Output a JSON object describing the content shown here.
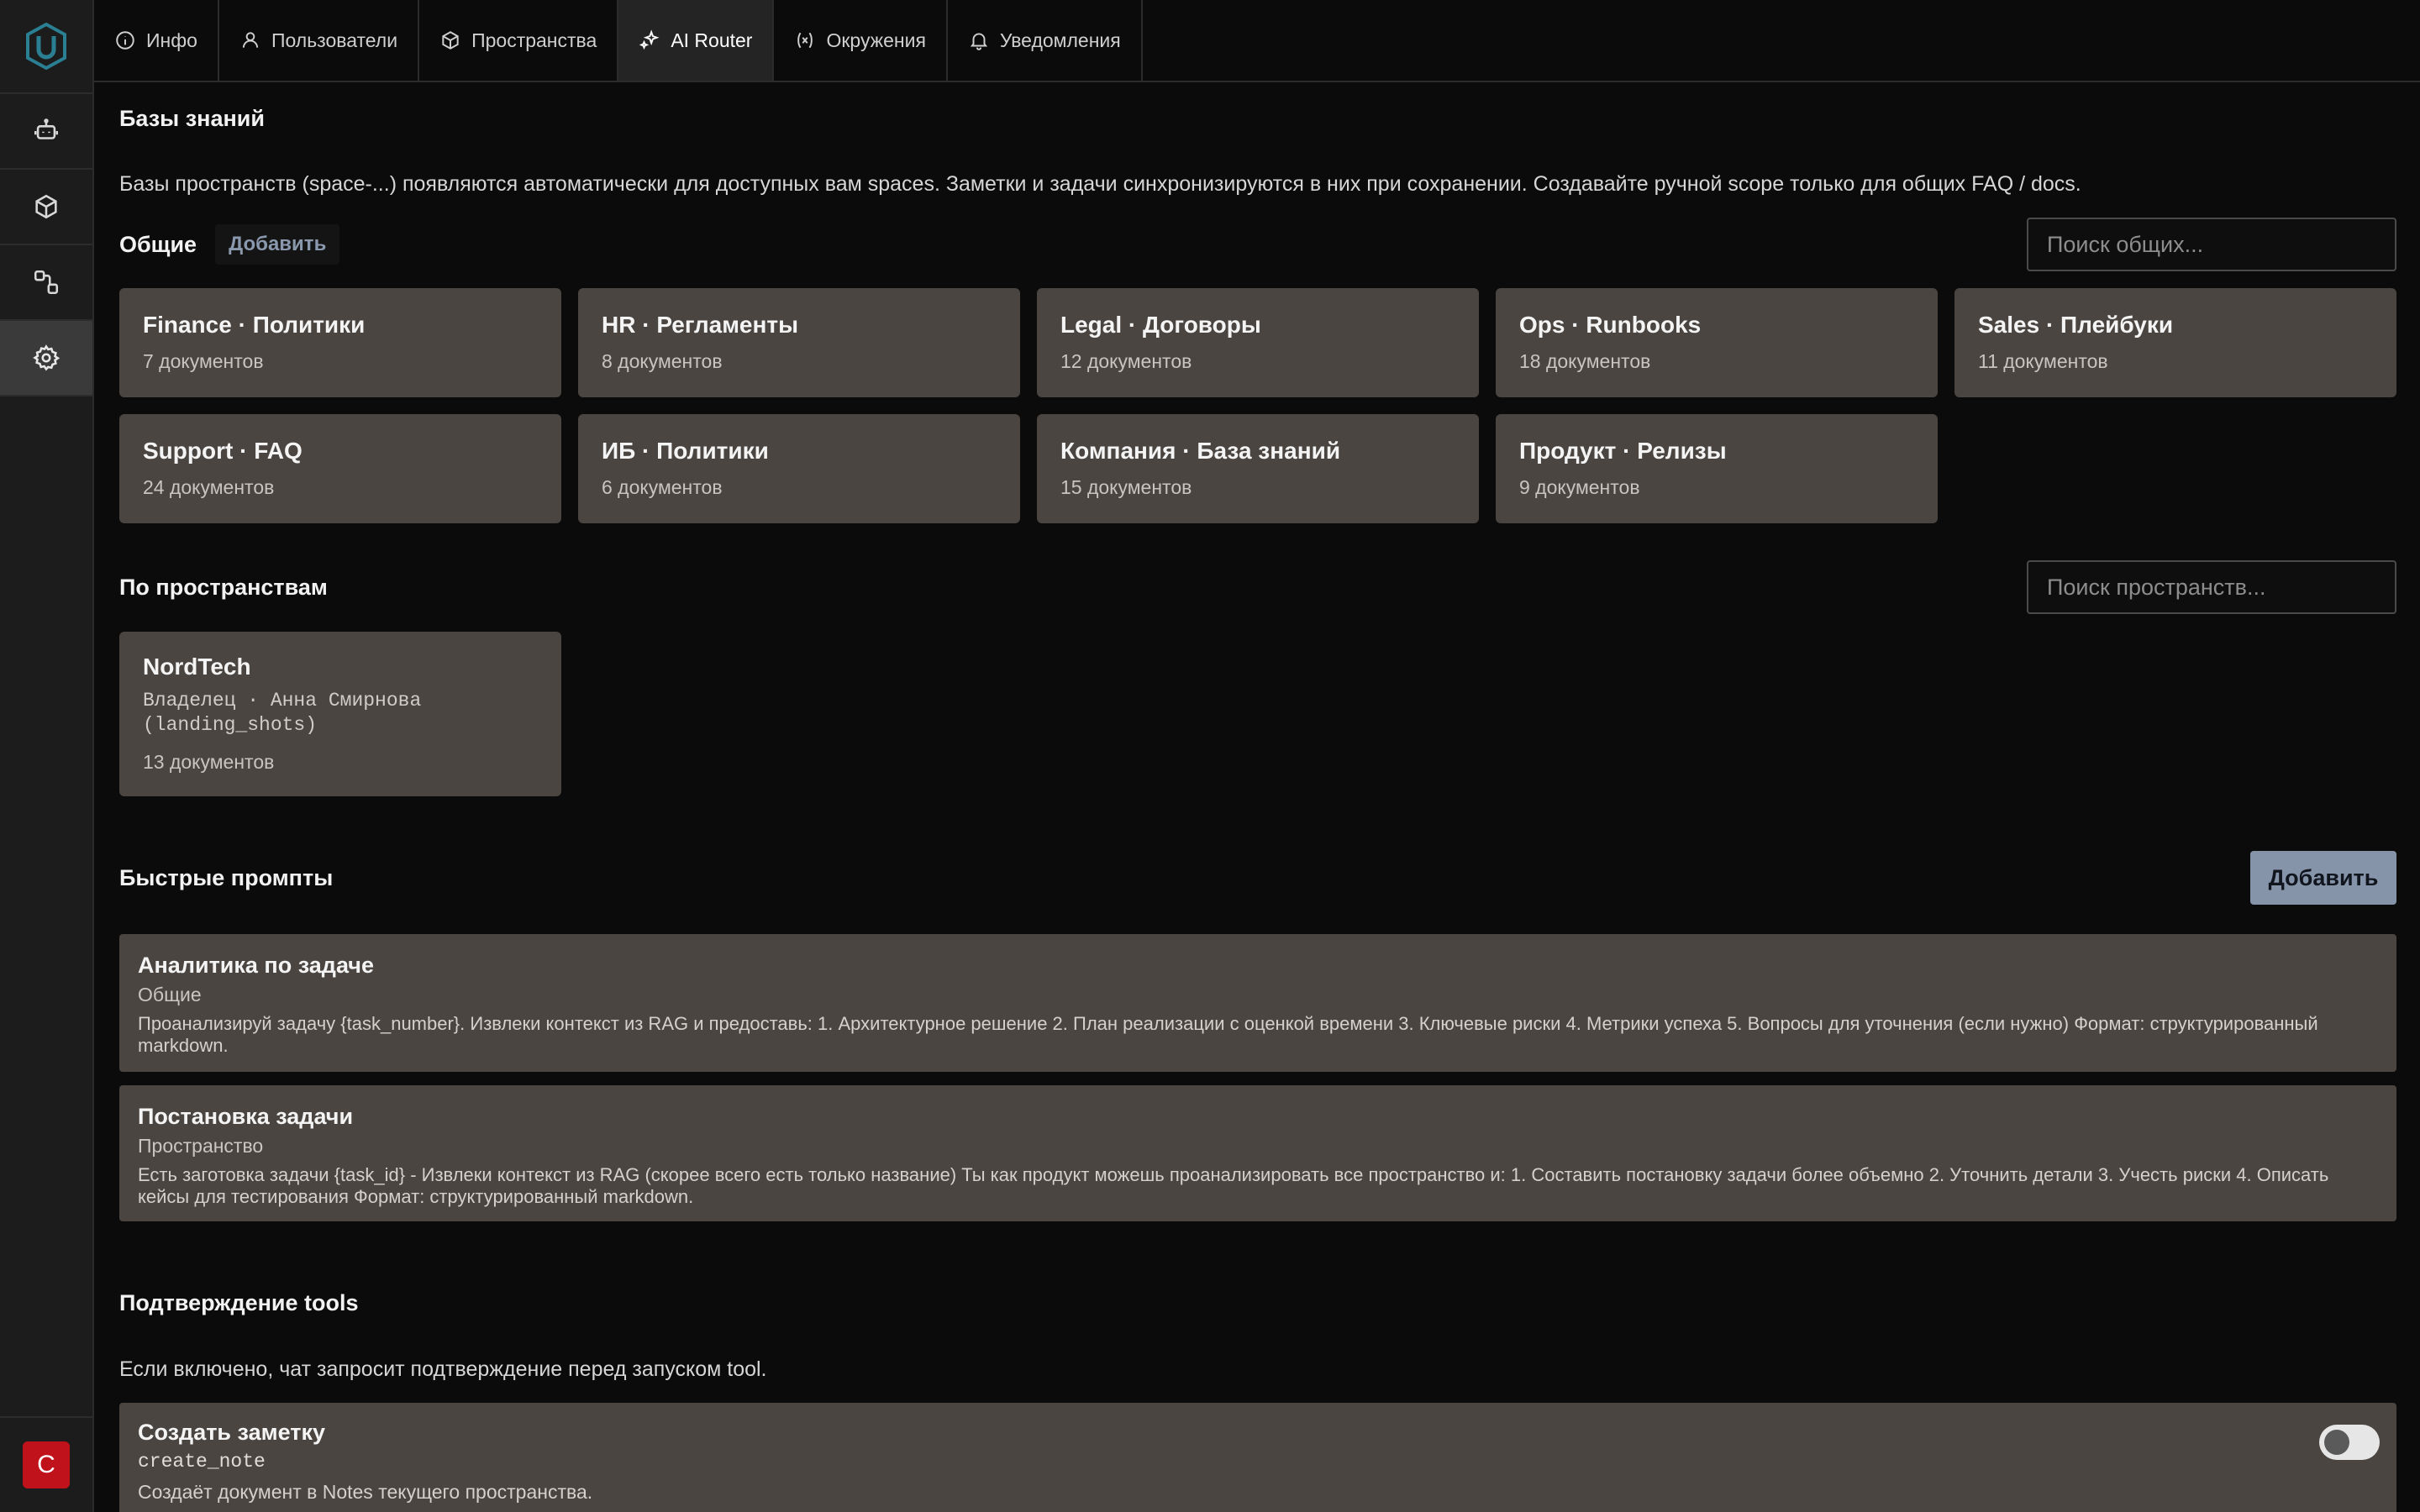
{
  "nav": {
    "user_initial": "C"
  },
  "tabs": [
    {
      "label": "Инфо",
      "icon": "info-icon"
    },
    {
      "label": "Пользователи",
      "icon": "user-icon"
    },
    {
      "label": "Пространства",
      "icon": "cube-icon"
    },
    {
      "label": "AI Router",
      "icon": "sparkles-icon"
    },
    {
      "label": "Окружения",
      "icon": "variable-icon"
    },
    {
      "label": "Уведомления",
      "icon": "bell-icon"
    }
  ],
  "active_tab": "AI Router",
  "knowledge": {
    "title": "Базы знаний",
    "description": "Базы пространств (space-...) появляются автоматически для доступных вам spaces. Заметки и задачи синхронизируются в них при сохранении. Создавайте ручной scope только для общих FAQ / docs.",
    "general_label": "Общие",
    "add_label": "Добавить",
    "search_general_placeholder": "Поиск общих...",
    "general_bases": [
      {
        "title": "Finance · Политики",
        "count": "7 документов"
      },
      {
        "title": "HR · Регламенты",
        "count": "8 документов"
      },
      {
        "title": "Legal · Договоры",
        "count": "12 документов"
      },
      {
        "title": "Ops · Runbooks",
        "count": "18 документов"
      },
      {
        "title": "Sales · Плейбуки",
        "count": "11 документов"
      },
      {
        "title": "Support · FAQ",
        "count": "24 документов"
      },
      {
        "title": "ИБ · Политики",
        "count": "6 документов"
      },
      {
        "title": "Компания · База знаний",
        "count": "15 документов"
      },
      {
        "title": "Продукт · Релизы",
        "count": "9 документов"
      }
    ],
    "by_space_label": "По пространствам",
    "search_spaces_placeholder": "Поиск пространств...",
    "spaces": [
      {
        "title": "NordTech",
        "owner_line1": "Владелец · Анна Смирнова",
        "owner_line2": "(landing_shots)",
        "count": "13 документов"
      }
    ]
  },
  "prompts": {
    "title": "Быстрые промпты",
    "add_label": "Добавить",
    "items": [
      {
        "title": "Аналитика по задаче",
        "scope": "Общие",
        "body": "Проанализируй задачу {task_number}. Извлеки контекст из RAG и предоставь: 1. Архитектурное решение 2. План реализации с оценкой времени 3. Ключевые риски 4. Метрики успеха 5. Вопросы для уточнения (если нужно) Формат: структурированный markdown."
      },
      {
        "title": "Постановка задачи",
        "scope": "Пространство",
        "body": "Есть заготовка задачи {task_id} - Извлеки контекст из RAG (скорее всего есть только название) Ты как продукт можешь проанализировать все пространство и: 1. Составить постановку задачи более объемно 2. Уточнить детали 3. Учесть риски 4. Описать кейсы для тестирования Формат: структурированный markdown."
      }
    ]
  },
  "tools": {
    "title": "Подтверждение tools",
    "description": "Если включено, чат запросит подтверждение перед запуском tool.",
    "items": [
      {
        "title": "Создать заметку",
        "code": "create_note",
        "description": "Создаёт документ в Notes текущего пространства.",
        "enabled": false
      }
    ]
  },
  "colors": {
    "accent": "#8694aa",
    "card": "#4a4541",
    "logo": "#2a7f93",
    "user_badge": "#c0121a"
  }
}
